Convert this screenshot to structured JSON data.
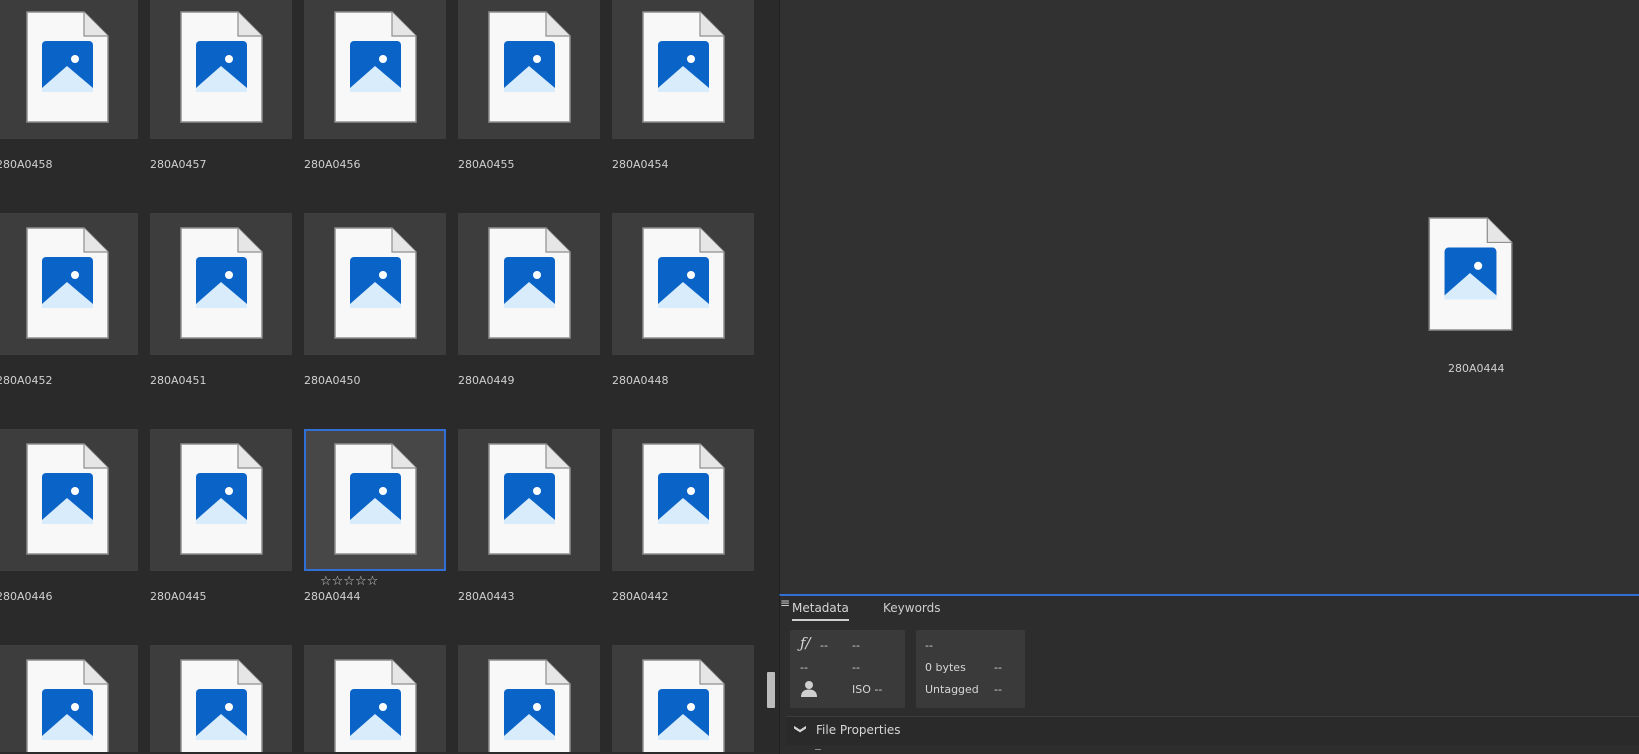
{
  "grid": {
    "items": [
      {
        "label": "280A0458"
      },
      {
        "label": "280A0457"
      },
      {
        "label": "280A0456"
      },
      {
        "label": "280A0455"
      },
      {
        "label": "280A0454"
      },
      {
        "label": "280A0452"
      },
      {
        "label": "280A0451"
      },
      {
        "label": "280A0450"
      },
      {
        "label": "280A0449"
      },
      {
        "label": "280A0448"
      },
      {
        "label": "280A0446"
      },
      {
        "label": "280A0445"
      },
      {
        "label": "280A0444"
      },
      {
        "label": "280A0443"
      },
      {
        "label": "280A0442"
      },
      {
        "label": ""
      },
      {
        "label": ""
      },
      {
        "label": ""
      },
      {
        "label": ""
      },
      {
        "label": ""
      }
    ],
    "selected_label": "280A0444",
    "rating_stars": "☆☆☆☆☆"
  },
  "preview": {
    "label": "280A0444"
  },
  "metadata": {
    "tabs": {
      "metadata": "Metadata",
      "keywords": "Keywords",
      "menu_icon": "≡"
    },
    "camera": {
      "aperture_icon": "ƒ/",
      "aperture": "--",
      "shutter": "--",
      "row2_left": "--",
      "row2_right": "--",
      "iso": "ISO --"
    },
    "file": {
      "row1": "--",
      "size": "0 bytes",
      "size_right": "--",
      "tag": "Untagged",
      "tag_right": "--"
    },
    "file_properties": {
      "title": "File Properties",
      "chevron": "❯"
    }
  },
  "colors": {
    "accent": "#2f6fd6",
    "icon_blue": "#0a64c8"
  }
}
